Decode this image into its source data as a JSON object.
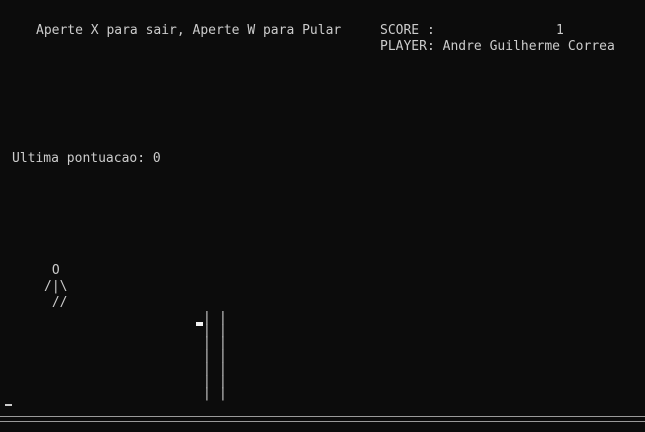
{
  "header": {
    "instructions": "Aperte X para sair, Aperte W para Pular",
    "score_label": "SCORE :",
    "score_value": "1",
    "player_line": "PLAYER: Andre Guilherme Correa"
  },
  "status": {
    "last_score_line": "Ultima pontuacao: 0"
  },
  "game": {
    "player_figure": " O\n/|\\\n //",
    "obstacle_left": "|\n|\n|\n|\n|\n|\n|",
    "obstacle_right": "|\n|\n|\n|\n|\n|\n|"
  },
  "colors": {
    "background": "#0c0c0c",
    "text": "#cccccc",
    "ground_line": "#9a9a9a"
  }
}
